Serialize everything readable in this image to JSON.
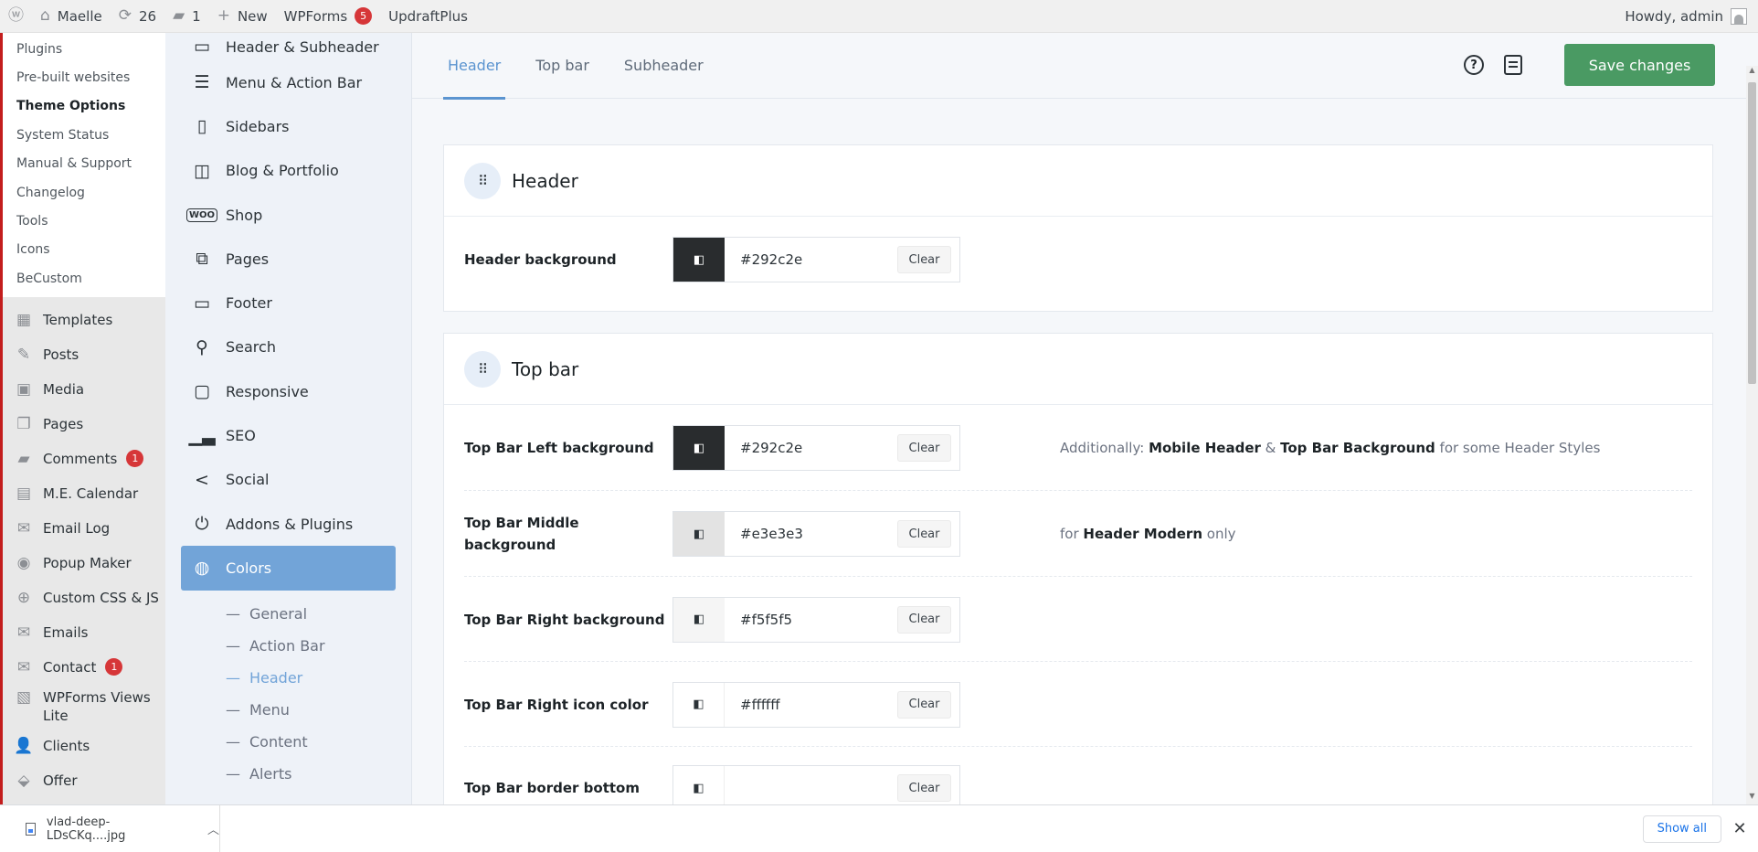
{
  "admin_bar": {
    "site_name": "Maelle",
    "updates_count": "26",
    "comments_count": "1",
    "new_label": "New",
    "wpforms_label": "WPForms",
    "wpforms_badge": "5",
    "updraft_label": "UpdraftPlus",
    "howdy": "Howdy, admin"
  },
  "wp_menu": {
    "submenu": [
      "Plugins",
      "Pre-built websites",
      "Theme Options",
      "System Status",
      "Manual & Support",
      "Changelog",
      "Tools",
      "Icons",
      "BeCustom"
    ],
    "items": [
      {
        "label": "Templates",
        "icon": "templates-icon"
      },
      {
        "label": "Posts",
        "icon": "pin-icon"
      },
      {
        "label": "Media",
        "icon": "media-icon"
      },
      {
        "label": "Pages",
        "icon": "pages-icon"
      },
      {
        "label": "Comments",
        "icon": "comment-icon",
        "badge": "1"
      },
      {
        "label": "M.E. Calendar",
        "icon": "calendar-icon"
      },
      {
        "label": "Email Log",
        "icon": "envelope-icon"
      },
      {
        "label": "Popup Maker",
        "icon": "popup-icon"
      },
      {
        "label": "Custom CSS & JS",
        "icon": "plus-circle-icon"
      },
      {
        "label": "Emails",
        "icon": "envelope-icon"
      },
      {
        "label": "Contact",
        "icon": "envelope-icon",
        "badge": "1"
      },
      {
        "label": "WPForms Views",
        "label2": "Lite",
        "icon": "forms-icon"
      },
      {
        "label": "Clients",
        "icon": "user-icon"
      },
      {
        "label": "Offer",
        "icon": "tag-icon"
      }
    ]
  },
  "theme_nav": {
    "items": [
      "Header & Subheader",
      "Menu & Action Bar",
      "Sidebars",
      "Blog & Portfolio",
      "Shop",
      "Pages",
      "Footer",
      "Search",
      "Responsive",
      "SEO",
      "Social",
      "Addons & Plugins",
      "Colors"
    ],
    "woo_text": "WOO",
    "colors_sub": [
      "General",
      "Action Bar",
      "Header",
      "Menu",
      "Content",
      "Alerts"
    ]
  },
  "tabs": [
    "Header",
    "Top bar",
    "Subheader"
  ],
  "toolbar": {
    "help_glyph": "?",
    "save_label": "Save changes"
  },
  "header_panel": {
    "title": "Header",
    "rows": [
      {
        "label": "Header background",
        "value": "#292c2e",
        "swatch": "#292c2e",
        "clear": "Clear"
      }
    ]
  },
  "topbar_panel": {
    "title": "Top bar",
    "rows": [
      {
        "label": "Top Bar Left background",
        "value": "#292c2e",
        "swatch": "#292c2e",
        "clear": "Clear"
      },
      {
        "label": "Top Bar Middle",
        "label2": "background",
        "value": "#e3e3e3",
        "swatch": "#e3e3e3",
        "clear": "Clear"
      },
      {
        "label": "Top Bar Right background",
        "value": "#f5f5f5",
        "swatch": "#f5f5f5",
        "clear": "Clear"
      },
      {
        "label": "Top Bar Right icon color",
        "value": "#ffffff",
        "swatch": "#ffffff",
        "clear": "Clear"
      },
      {
        "label": "Top Bar border bottom",
        "value": "",
        "swatch": "#ffffff",
        "clear": "Clear"
      }
    ],
    "note1": {
      "prefix": "Additionally: ",
      "b1": "Mobile Header",
      "mid": " & ",
      "b2": "Top Bar Background",
      "suffix": " for some Header Styles"
    },
    "note2": {
      "prefix": "for ",
      "b1": "Header Modern",
      "suffix": " only"
    }
  },
  "downloads": {
    "file": "vlad-deep-LDsCKq....jpg",
    "show_all": "Show all"
  }
}
